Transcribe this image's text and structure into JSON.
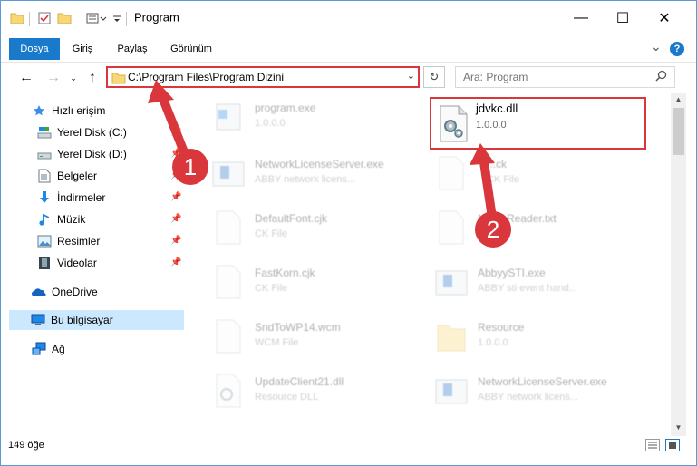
{
  "window": {
    "title": "Program",
    "minimize": "—",
    "maximize": "☐",
    "close": "✕"
  },
  "ribbon": {
    "tabs": [
      "Dosya",
      "Giriş",
      "Paylaş",
      "Görünüm"
    ],
    "expand": "⌄",
    "help": "?"
  },
  "address": {
    "path": "C:\\Program Files\\Program Dizini",
    "search_placeholder": "Ara: Program"
  },
  "nav": {
    "quick_access": "Hızlı erişim",
    "items": [
      "Yerel Disk (C:)",
      "Yerel Disk (D:)",
      "Belgeler",
      "İndirmeler",
      "Müzik",
      "Resimler",
      "Videolar"
    ],
    "onedrive": "OneDrive",
    "this_pc": "Bu bilgisayar",
    "network": "Ağ"
  },
  "files": [
    {
      "name": "program.exe",
      "sub": "1.0.0.0"
    },
    {
      "name": "jdvkc.dll",
      "sub": "1.0.0.0"
    },
    {
      "name": "NetworkLicenseServer.exe",
      "sub": "ABBY network licens..."
    },
    {
      "name": "...ck",
      "sub": "CK File"
    },
    {
      "name": "DefaultFont.cjk",
      "sub": "CK File"
    },
    {
      "name": "N...neReader.txt",
      "sub": ""
    },
    {
      "name": "FastKorn.cjk",
      "sub": "CK File"
    },
    {
      "name": "AbbyySTI.exe",
      "sub": "ABBY sti event hand..."
    },
    {
      "name": "SndToWP14.wcm",
      "sub": "WCM File"
    },
    {
      "name": "Resource",
      "sub": "1.0.0.0"
    },
    {
      "name": "UpdateClient21.dll",
      "sub": "Resource DLL"
    },
    {
      "name": "NetworkLicenseServer.exe",
      "sub": "ABBY network licens..."
    }
  ],
  "status": {
    "count": "149 öğe"
  },
  "callouts": {
    "one": "1",
    "two": "2"
  },
  "colors": {
    "accent": "#1979ca",
    "highlight": "#d9373c",
    "selection": "#cce8ff"
  }
}
